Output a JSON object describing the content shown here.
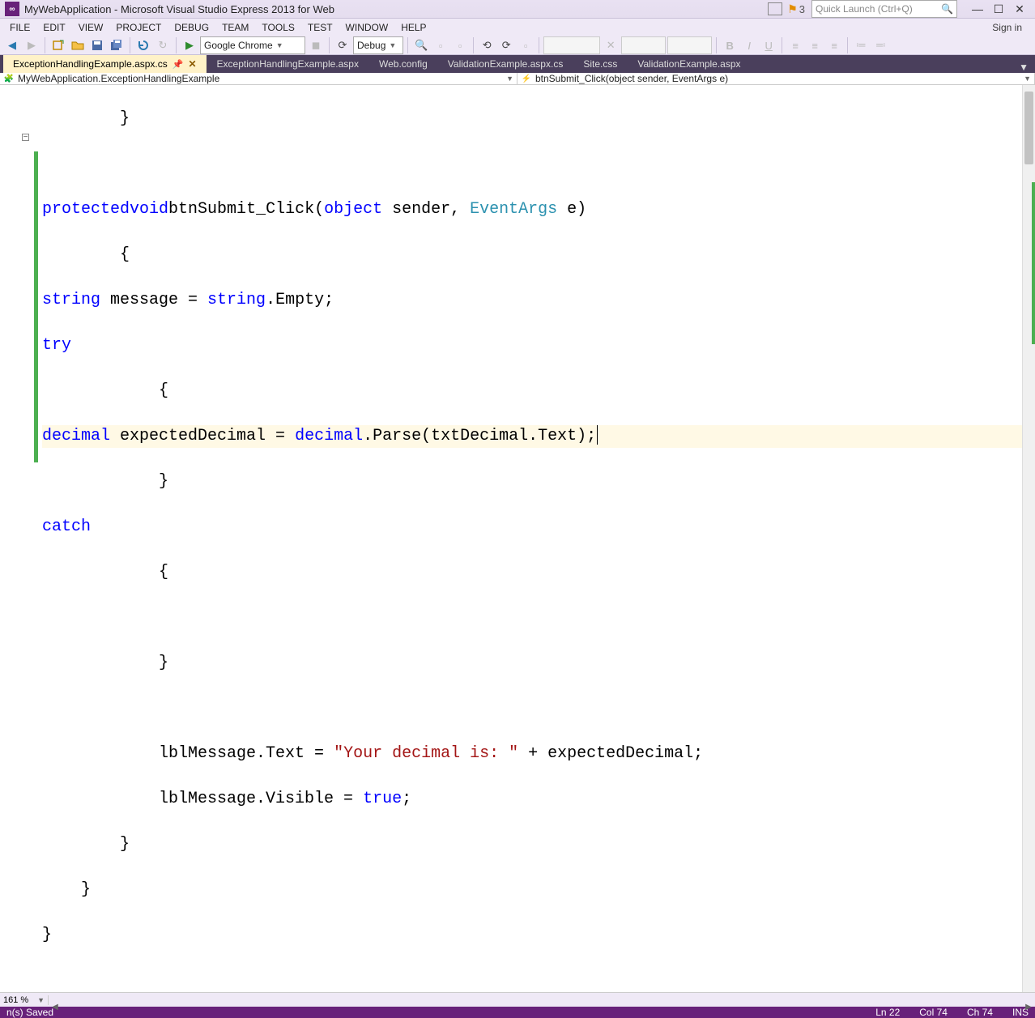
{
  "title": "MyWebApplication - Microsoft Visual Studio Express 2013 for Web",
  "notif_count": "3",
  "quicklaunch_placeholder": "Quick Launch (Ctrl+Q)",
  "signin": "Sign in",
  "menu": [
    "FILE",
    "EDIT",
    "VIEW",
    "PROJECT",
    "DEBUG",
    "TEAM",
    "TOOLS",
    "TEST",
    "WINDOW",
    "HELP"
  ],
  "toolbar": {
    "browser": "Google Chrome",
    "config": "Debug"
  },
  "tabs": [
    {
      "label": "ExceptionHandlingExample.aspx.cs",
      "active": true,
      "pinned": true,
      "closable": true
    },
    {
      "label": "ExceptionHandlingExample.aspx"
    },
    {
      "label": "Web.config"
    },
    {
      "label": "ValidationExample.aspx.cs"
    },
    {
      "label": "Site.css"
    },
    {
      "label": "ValidationExample.aspx"
    }
  ],
  "nav": {
    "left": "MyWebApplication.ExceptionHandlingExample",
    "right": "btnSubmit_Click(object sender, EventArgs e)"
  },
  "code": {
    "l1": "        }",
    "l3_kw1": "protected",
    "l3_kw2": "void",
    "l3_name": "btnSubmit_Click(",
    "l3_kw3": "object",
    "l3_sender": " sender, ",
    "l3_type": "EventArgs",
    "l3_e": " e)",
    "l4": "        {",
    "l5_kw": "string",
    "l5_rest1": " message = ",
    "l5_kw2": "string",
    "l5_rest2": ".Empty;",
    "l6_kw": "try",
    "l7": "            {",
    "l8_kw": "decimal",
    "l8_mid": " expectedDecimal = ",
    "l8_kw2": "decimal",
    "l8_rest": ".Parse(txtDecimal.Text);",
    "l9": "            }",
    "l10_kw": "catch",
    "l11": "            {",
    "l12": "",
    "l13": "            }",
    "l14": "",
    "l15a": "            lblMessage.Text = ",
    "l15str": "\"Your decimal is: \"",
    "l15b": " + expectedDecimal;",
    "l16a": "            lblMessage.Visible = ",
    "l16kw": "true",
    "l16b": ";",
    "l17": "        }",
    "l18": "    }",
    "l19": "}"
  },
  "zoom": "161 %",
  "status": {
    "left": "n(s) Saved",
    "ln": "Ln 22",
    "col": "Col 74",
    "ch": "Ch 74",
    "ins": "INS"
  }
}
